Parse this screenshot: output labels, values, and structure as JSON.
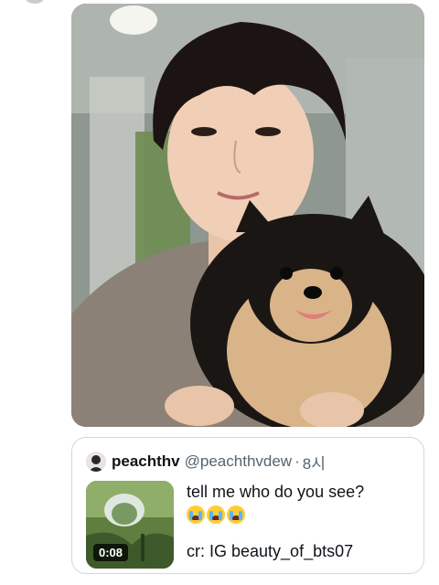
{
  "media": {
    "photo_icon": "photo-person-with-dog"
  },
  "quote": {
    "name": "peachthv",
    "handle": "@peachthvdew",
    "separator": "·",
    "time": "8시",
    "text": "tell me who do you see?",
    "emojis": [
      "😭",
      "😭",
      "😭"
    ],
    "credit": "cr: IG beauty_of_bts07",
    "video_duration": "0:08"
  }
}
